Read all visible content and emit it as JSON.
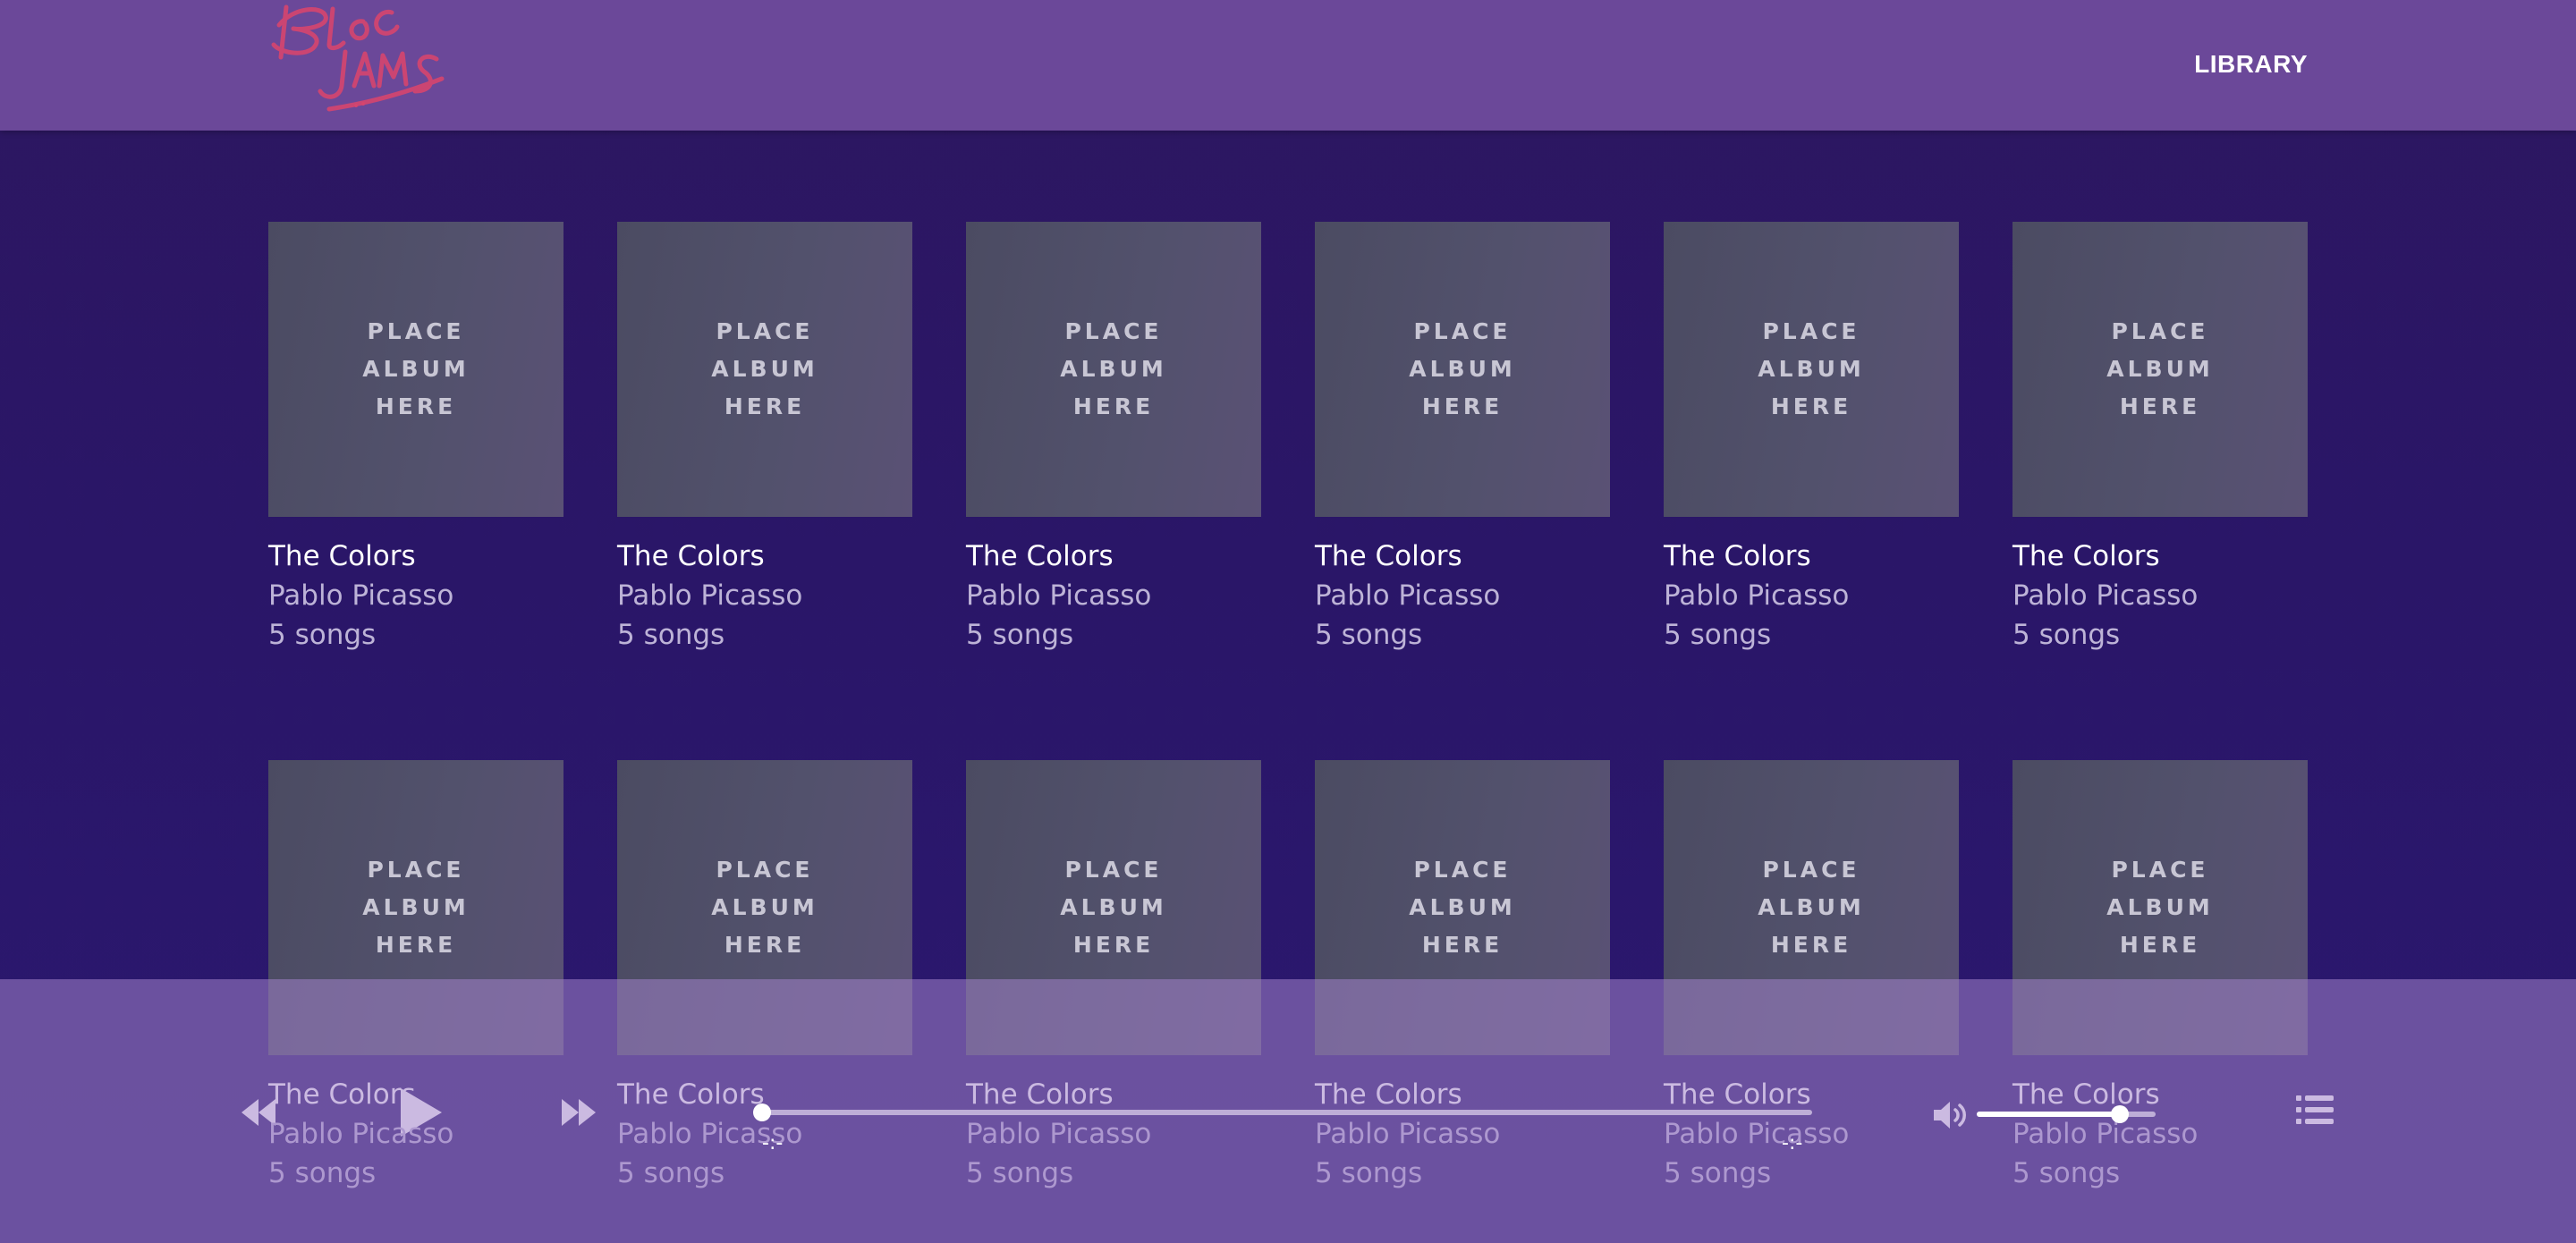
{
  "navbar": {
    "logo_text": "Bloc Jams",
    "library_link": "LIBRARY"
  },
  "colors": {
    "navbar": "#6b4899",
    "background": "#2d1760",
    "logo": "#d6456e",
    "album_cover": "#4f4e68",
    "player_bar": "#a082c8"
  },
  "albums": [
    {
      "cover": [
        "PLACE",
        "ALBUM",
        "HERE"
      ],
      "title": "The Colors",
      "artist": "Pablo Picasso",
      "songs": "5 songs"
    },
    {
      "cover": [
        "PLACE",
        "ALBUM",
        "HERE"
      ],
      "title": "The Colors",
      "artist": "Pablo Picasso",
      "songs": "5 songs"
    },
    {
      "cover": [
        "PLACE",
        "ALBUM",
        "HERE"
      ],
      "title": "The Colors",
      "artist": "Pablo Picasso",
      "songs": "5 songs"
    },
    {
      "cover": [
        "PLACE",
        "ALBUM",
        "HERE"
      ],
      "title": "The Colors",
      "artist": "Pablo Picasso",
      "songs": "5 songs"
    },
    {
      "cover": [
        "PLACE",
        "ALBUM",
        "HERE"
      ],
      "title": "The Colors",
      "artist": "Pablo Picasso",
      "songs": "5 songs"
    },
    {
      "cover": [
        "PLACE",
        "ALBUM",
        "HERE"
      ],
      "title": "The Colors",
      "artist": "Pablo Picasso",
      "songs": "5 songs"
    },
    {
      "cover": [
        "PLACE",
        "ALBUM",
        "HERE"
      ],
      "title": "The Colors",
      "artist": "Pablo Picasso",
      "songs": "5 songs"
    },
    {
      "cover": [
        "PLACE",
        "ALBUM",
        "HERE"
      ],
      "title": "The Colors",
      "artist": "Pablo Picasso",
      "songs": "5 songs"
    },
    {
      "cover": [
        "PLACE",
        "ALBUM",
        "HERE"
      ],
      "title": "The Colors",
      "artist": "Pablo Picasso",
      "songs": "5 songs"
    },
    {
      "cover": [
        "PLACE",
        "ALBUM",
        "HERE"
      ],
      "title": "The Colors",
      "artist": "Pablo Picasso",
      "songs": "5 songs"
    },
    {
      "cover": [
        "PLACE",
        "ALBUM",
        "HERE"
      ],
      "title": "The Colors",
      "artist": "Pablo Picasso",
      "songs": "5 songs"
    },
    {
      "cover": [
        "PLACE",
        "ALBUM",
        "HERE"
      ],
      "title": "The Colors",
      "artist": "Pablo Picasso",
      "songs": "5 songs"
    }
  ],
  "player": {
    "controls": {
      "previous_icon": "rewind-icon",
      "play_icon": "play-icon",
      "next_icon": "fast-forward-icon",
      "volume_icon": "volume-icon",
      "playlist_icon": "list-icon"
    },
    "seek_position": 0,
    "seek_tick_start": "-:-",
    "seek_tick_end": "-:-",
    "volume_level": 0.8
  }
}
